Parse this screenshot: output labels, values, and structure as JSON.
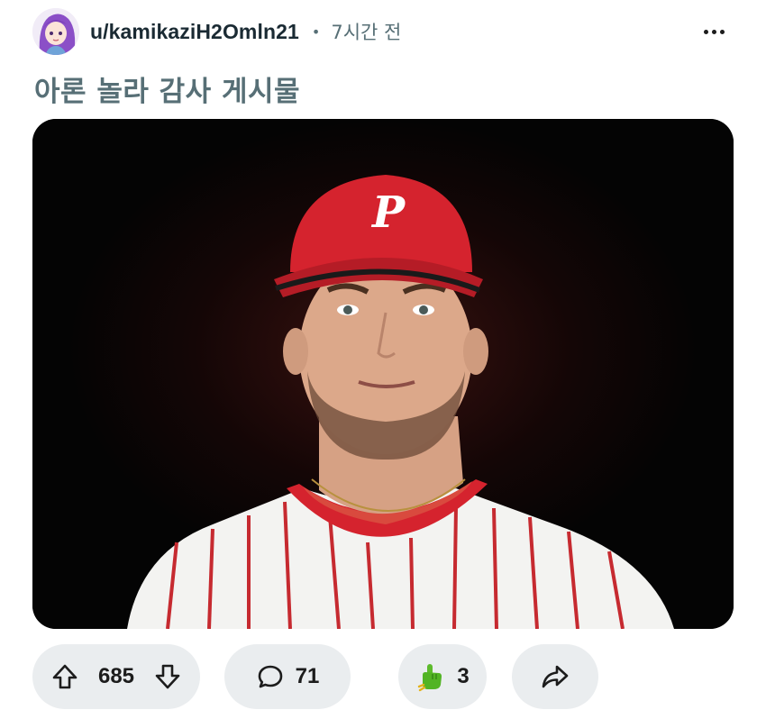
{
  "post": {
    "username": "u/kamikaziH2Omln21",
    "separator": "•",
    "time": "7시간 전",
    "title": "아론 놀라 감사 게시물"
  },
  "actions": {
    "upvotes": "685",
    "comments": "71",
    "awards": "3"
  },
  "icons": {
    "more": "more-dots-icon",
    "upvote": "arrow-up-icon",
    "downvote": "arrow-down-icon",
    "comment": "speech-bubble-icon",
    "award": "pointing-hand-award-icon",
    "share": "share-arrow-icon"
  },
  "colors": {
    "cap_red": "#d5232e",
    "pill_bg": "#eaedef",
    "muted_text": "#576f76"
  }
}
